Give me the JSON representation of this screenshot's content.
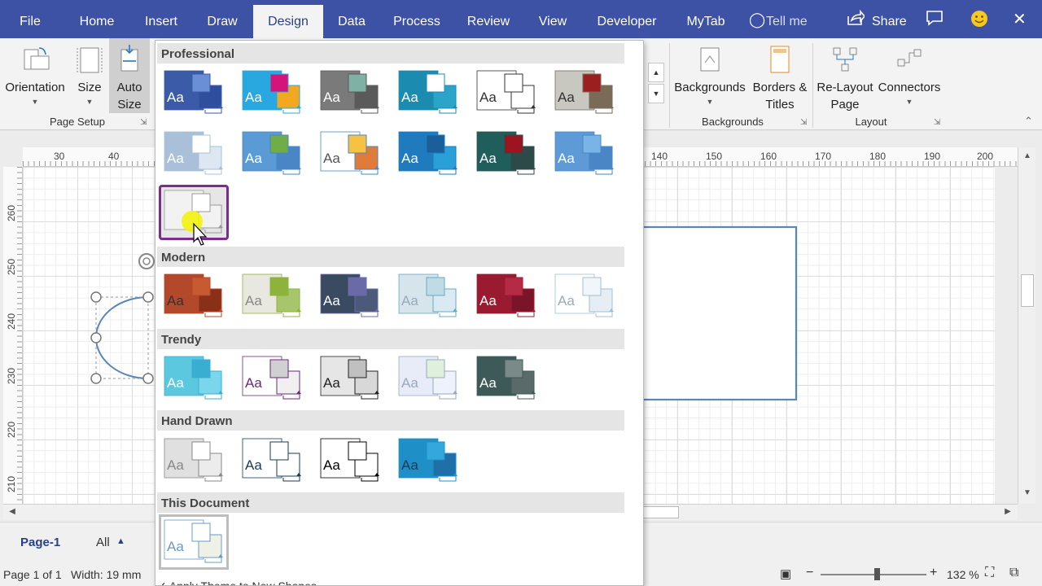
{
  "ribbon_tabs": [
    {
      "label": "File"
    },
    {
      "label": "Home"
    },
    {
      "label": "Insert"
    },
    {
      "label": "Draw"
    },
    {
      "label": "Design"
    },
    {
      "label": "Data"
    },
    {
      "label": "Process"
    },
    {
      "label": "Review"
    },
    {
      "label": "View"
    },
    {
      "label": "Developer"
    },
    {
      "label": "MyTab"
    }
  ],
  "active_tab": "Design",
  "tell_me": "Tell me",
  "share": "Share",
  "page_setup": {
    "orientation": "Orientation",
    "size": "Size",
    "auto_size_line1": "Auto",
    "auto_size_line2": "Size",
    "group_label": "Page Setup"
  },
  "backgrounds": {
    "backgrounds_label": "Backgrounds",
    "borders_line1": "Borders &",
    "borders_line2": "Titles",
    "group_label": "Backgrounds"
  },
  "layout": {
    "relayout_line1": "Re-Layout",
    "relayout_line2": "Page",
    "connectors": "Connectors",
    "group_label": "Layout"
  },
  "ruler": {
    "h_ticks": [
      "30",
      "40",
      "140",
      "150",
      "160",
      "170",
      "180",
      "190",
      "200"
    ],
    "v_ticks": [
      "260",
      "250",
      "240",
      "230",
      "220",
      "210"
    ]
  },
  "gallery": {
    "sections": [
      {
        "title": "Professional",
        "count": 13
      },
      {
        "title": "Modern",
        "count": 6
      },
      {
        "title": "Trendy",
        "count": 5
      },
      {
        "title": "Hand Drawn",
        "count": 4
      },
      {
        "title": "This Document",
        "count": 1
      }
    ],
    "thumb_text": "Aa",
    "footer": "Apply Theme to New Shapes"
  },
  "page_tabs": {
    "current": "Page-1",
    "all": "All"
  },
  "status": {
    "page": "Page 1 of 1",
    "width": "Width: 19 mm",
    "zoom": "132 %"
  },
  "colors": {
    "ribbon_blue": "#3d52a4",
    "selection_border": "#7a2d8d",
    "shape_stroke": "#5a86b8"
  }
}
